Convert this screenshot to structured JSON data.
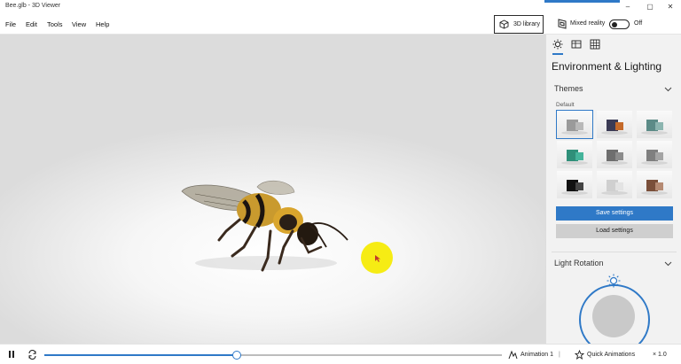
{
  "window": {
    "title": "Bee.glb - 3D Viewer",
    "minimize": "–",
    "maximize": "▢",
    "close": "✕"
  },
  "menu": {
    "items": [
      "File",
      "Edit",
      "Tools",
      "View",
      "Help"
    ]
  },
  "toolbar": {
    "library_label": "3D library",
    "mixed_reality_label": "Mixed reality",
    "mixed_reality_state": "Off"
  },
  "panel": {
    "tabs": [
      {
        "icon": "sun-icon",
        "active": true
      },
      {
        "icon": "grid-stats-icon",
        "active": false
      },
      {
        "icon": "grid-icon",
        "active": false
      }
    ],
    "title": "Environment & Lighting",
    "themes": {
      "header": "Themes",
      "selected_label": "Default",
      "thumbnails": [
        {
          "name": "theme-default",
          "selected": true,
          "colors": [
            "#9a9a9a",
            "#b8b8b8"
          ]
        },
        {
          "name": "theme-2",
          "selected": false,
          "colors": [
            "#3b3b55",
            "#c56a2a"
          ]
        },
        {
          "name": "theme-3",
          "selected": false,
          "colors": [
            "#5c8b87",
            "#8cb5b0"
          ]
        },
        {
          "name": "theme-4",
          "selected": false,
          "colors": [
            "#2f8f79",
            "#45b49b"
          ]
        },
        {
          "name": "theme-5",
          "selected": false,
          "colors": [
            "#6e6e6e",
            "#8c8c8c"
          ]
        },
        {
          "name": "theme-6",
          "selected": false,
          "colors": [
            "#7f7f7f",
            "#a4a4a4"
          ]
        },
        {
          "name": "theme-7",
          "selected": false,
          "colors": [
            "#111111",
            "#444444"
          ]
        },
        {
          "name": "theme-8",
          "selected": false,
          "colors": [
            "#cfcfcf",
            "#e3e3e3"
          ]
        },
        {
          "name": "theme-9",
          "selected": false,
          "colors": [
            "#7a4f3a",
            "#b58a73"
          ]
        }
      ]
    },
    "save_label": "Save settings",
    "load_label": "Load settings",
    "light_rotation_header": "Light Rotation"
  },
  "playback": {
    "progress": 0.42,
    "animation_label": "Animation 1",
    "quick_animations_label": "Quick Animations",
    "speed_label": "× 1.0"
  },
  "colors": {
    "accent": "#2f79c7",
    "cursor_highlight": "#f6ec14"
  }
}
